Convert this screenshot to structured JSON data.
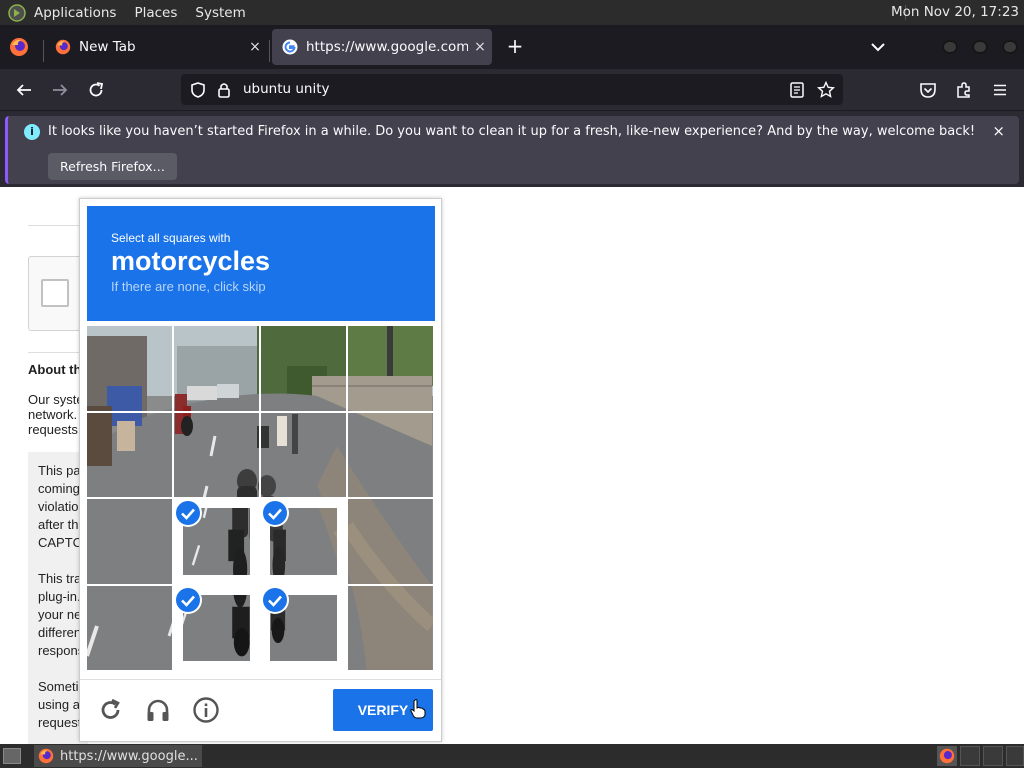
{
  "top_panel": {
    "menus": [
      "Applications",
      "Places",
      "System"
    ],
    "clock": "Mon Nov 20, 17:23"
  },
  "tabs": [
    {
      "label": "New Tab",
      "close": "×"
    },
    {
      "label": "https://www.google.com/se",
      "close": "×"
    }
  ],
  "new_tab_symbol": "+",
  "address_bar": {
    "value": "ubuntu unity"
  },
  "notification": {
    "info_symbol": "i",
    "message": "It looks like you haven’t started Firefox in a while. Do you want to clean it up for a fresh, like-new experience? And by the way, welcome back!",
    "button": "Refresh Firefox…",
    "close": "×"
  },
  "page": {
    "about_heading": "About th",
    "about_lines": [
      "Our syste",
      "network.",
      "requests"
    ],
    "info_para1": [
      "This pa",
      "coming",
      "violatio",
      "after th",
      "CAPTC"
    ],
    "info_para2": [
      "This tra",
      "plug-in.",
      "your ne",
      "differen",
      "respons"
    ],
    "info_para3": [
      "Someti",
      "using a",
      "request"
    ]
  },
  "captcha": {
    "instruction_pre": "Select all squares with",
    "target": "motorcycles",
    "instruction_sub": "If there are none, click skip",
    "selected_tiles": [
      9,
      10,
      13,
      14
    ],
    "verify_label": "VERIFY"
  },
  "taskbar": {
    "task_label": "https://www.google..."
  },
  "colors": {
    "captcha_blue": "#1a73e8",
    "firefox_dark": "#1c1b22",
    "toolbar": "#2b2a33"
  }
}
